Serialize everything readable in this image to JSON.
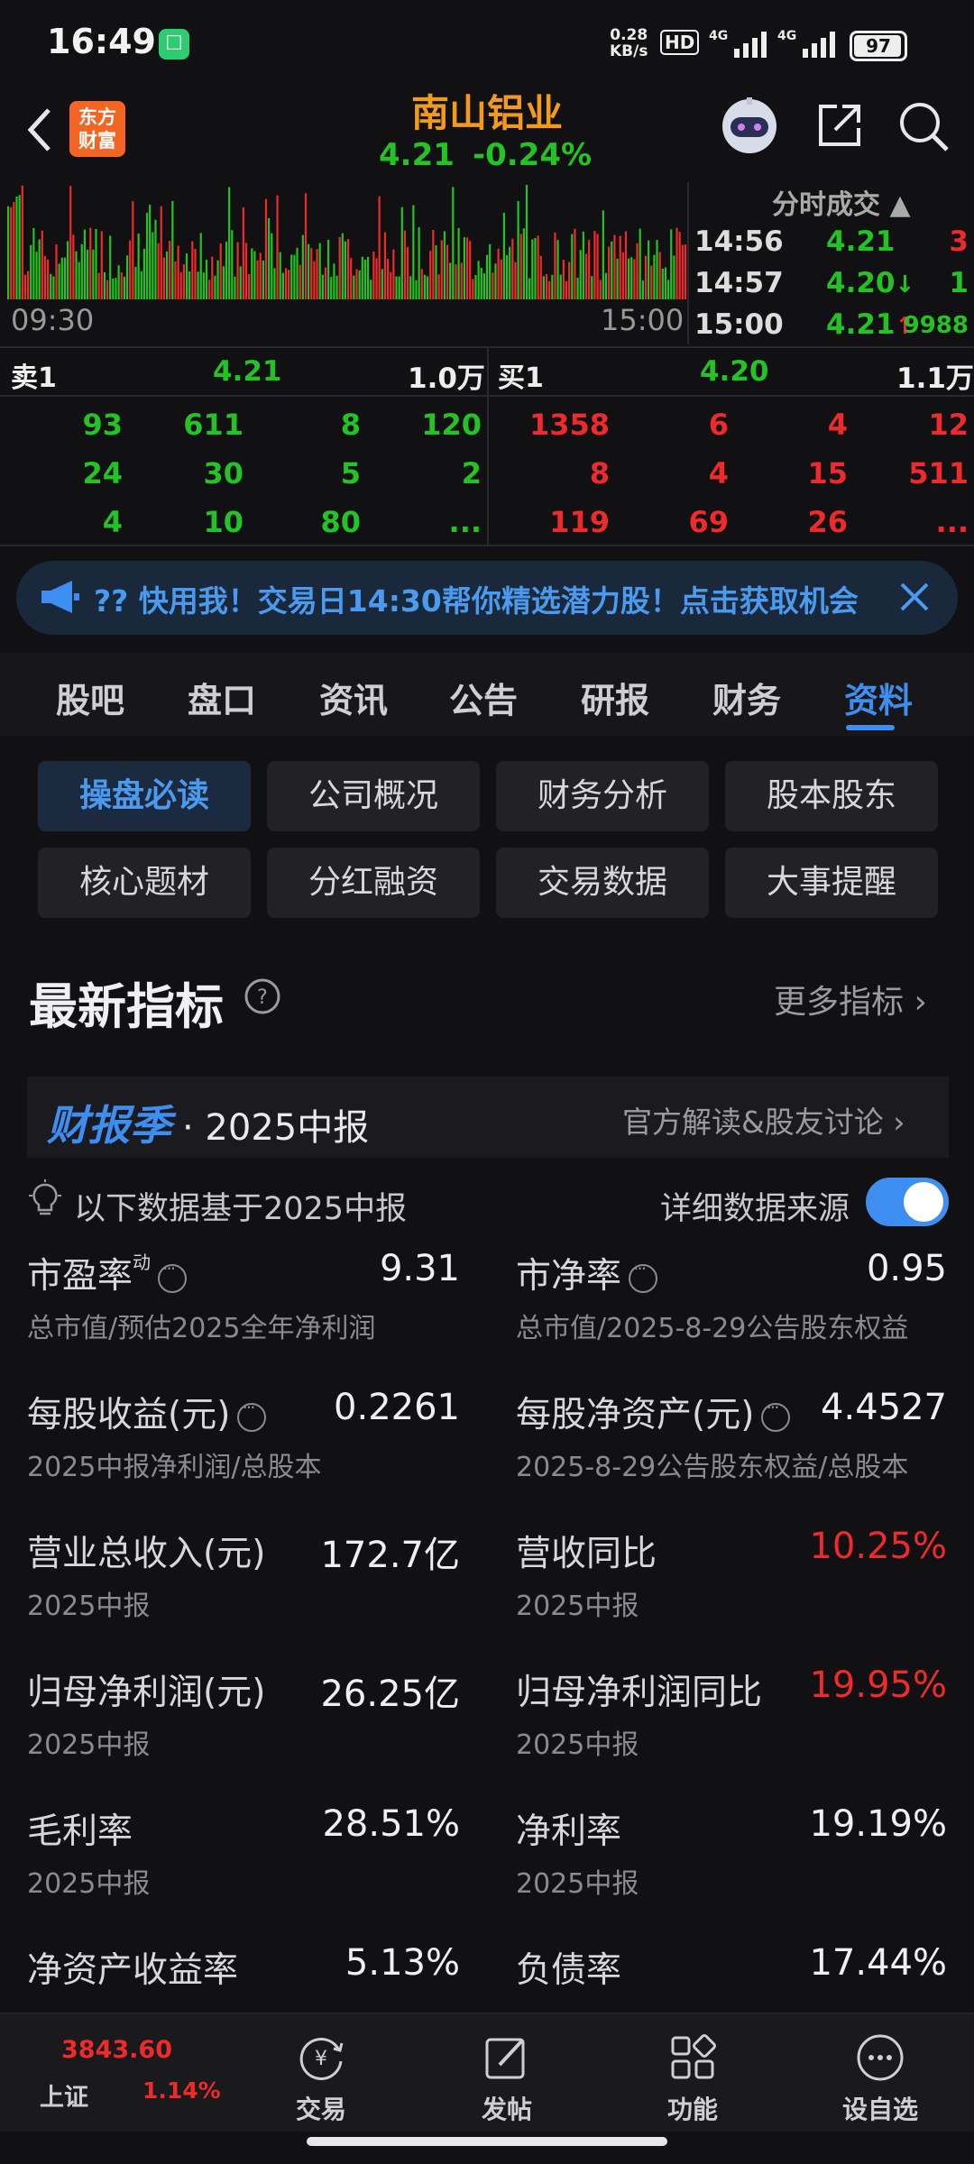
{
  "status": {
    "time": "16:49",
    "net_speed_value": "0.28",
    "net_speed_unit": "KB/s",
    "hd": "HD",
    "signal1": "4G",
    "signal2": "4G",
    "battery": "97"
  },
  "header": {
    "logo_line1": "东方",
    "logo_line2": "财富",
    "stock_name": "南山铝业",
    "price": "4.21",
    "change": "-0.24%"
  },
  "chart": {
    "start_time": "09:30",
    "end_time": "15:00"
  },
  "ticks": {
    "header": "分时成交",
    "rows": [
      {
        "time": "14:56",
        "price": "4.21",
        "arrow": "",
        "vol": "3",
        "price_color": "#22c322",
        "vol_color": "#ee2a2a"
      },
      {
        "time": "14:57",
        "price": "4.20",
        "arrow": "↓",
        "vol": "1",
        "price_color": "#22c322",
        "vol_color": "#22c322"
      },
      {
        "time": "15:00",
        "price": "4.21",
        "arrow": "↑",
        "vol": "9988",
        "price_color": "#22c322",
        "vol_color": "#22c322"
      }
    ]
  },
  "orderbook": {
    "sell_label": "卖1",
    "sell_price": "4.21",
    "sell_vol": "1.0万",
    "buy_label": "买1",
    "buy_price": "4.20",
    "buy_vol": "1.1万",
    "sell_rows": [
      [
        "93",
        "611",
        "8",
        "120"
      ],
      [
        "24",
        "30",
        "5",
        "2"
      ],
      [
        "4",
        "10",
        "80",
        "..."
      ]
    ],
    "buy_rows": [
      [
        "1358",
        "6",
        "4",
        "12"
      ],
      [
        "8",
        "4",
        "15",
        "511"
      ],
      [
        "119",
        "69",
        "26",
        "..."
      ]
    ]
  },
  "banner": {
    "text": "?? 快用我！交易日14:30帮你精选潜力股！点击获取机会"
  },
  "tabs": [
    "股吧",
    "盘口",
    "资讯",
    "公告",
    "研报",
    "财务",
    "资料"
  ],
  "subnav": [
    "操盘必读",
    "公司概况",
    "财务分析",
    "股本股东",
    "核心题材",
    "分红融资",
    "交易数据",
    "大事提醒"
  ],
  "section": {
    "title": "最新指标",
    "more": "更多指标",
    "season_tag": "财报季",
    "season_sub": "· 2025中报",
    "season_link": "官方解读&股友讨论",
    "basis": "以下数据基于2025中报",
    "source_label": "详细数据来源"
  },
  "metrics": [
    {
      "label": "市盈率",
      "sup": "动",
      "value": "9.31",
      "sub": "总市值/预估2025全年净利润",
      "color": "#f0f0f2"
    },
    {
      "label": "市净率",
      "value": "0.95",
      "sub": "总市值/2025-8-29公告股东权益",
      "color": "#f0f0f2"
    },
    {
      "label": "每股收益(元)",
      "value": "0.2261",
      "sub": "2025中报净利润/总股本",
      "color": "#f0f0f2"
    },
    {
      "label": "每股净资产(元)",
      "value": "4.4527",
      "sub": "2025-8-29公告股东权益/总股本",
      "color": "#f0f0f2"
    },
    {
      "label": "营业总收入(元)",
      "value": "172.7亿",
      "sub": "2025中报",
      "color": "#f0f0f2"
    },
    {
      "label": "营收同比",
      "value": "10.25%",
      "sub": "2025中报",
      "color": "#ee2a2a"
    },
    {
      "label": "归母净利润(元)",
      "value": "26.25亿",
      "sub": "2025中报",
      "color": "#f0f0f2"
    },
    {
      "label": "归母净利润同比",
      "value": "19.95%",
      "sub": "2025中报",
      "color": "#ee2a2a"
    },
    {
      "label": "毛利率",
      "value": "28.51%",
      "sub": "2025中报",
      "color": "#f0f0f2"
    },
    {
      "label": "净利率",
      "value": "19.19%",
      "sub": "2025中报",
      "color": "#f0f0f2"
    },
    {
      "label": "净资产收益率",
      "value": "5.13%",
      "sub": "",
      "color": "#f0f0f2"
    },
    {
      "label": "负债率",
      "value": "17.44%",
      "sub": "",
      "color": "#f0f0f2"
    }
  ],
  "bottom": {
    "index_value": "3843.60",
    "index_name": "上证",
    "index_change": "1.14%",
    "items": [
      "交易",
      "发帖",
      "功能",
      "设自选"
    ]
  }
}
